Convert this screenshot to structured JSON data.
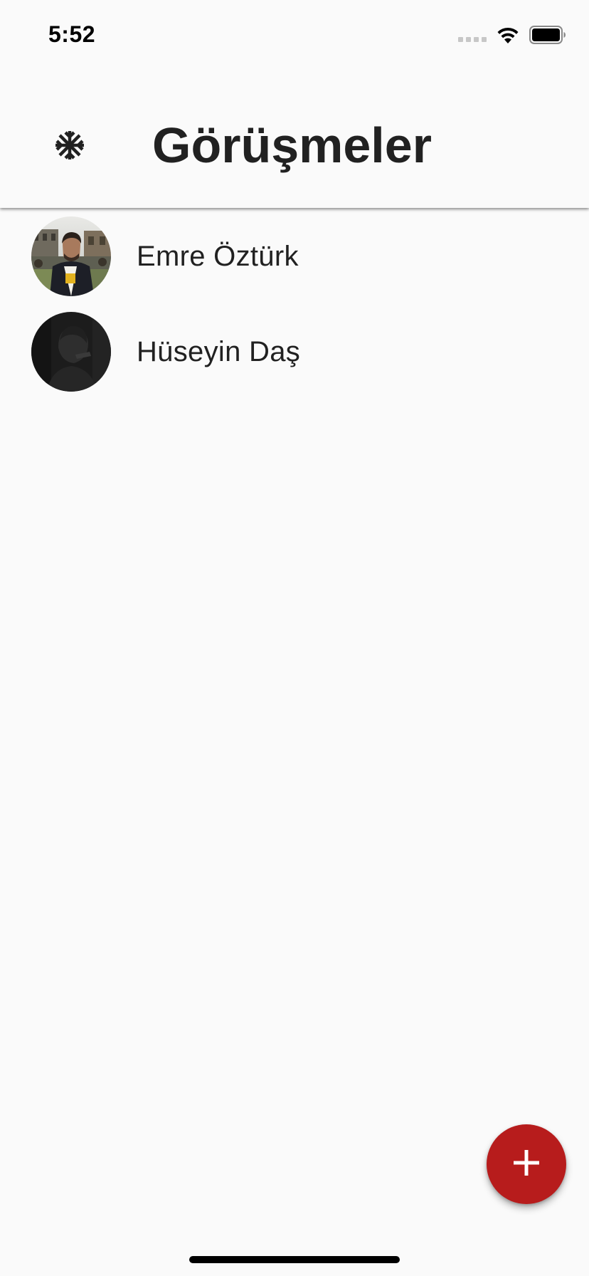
{
  "status_bar": {
    "time": "5:52",
    "icons": [
      "signal-icon",
      "wifi-icon",
      "battery-icon"
    ]
  },
  "app_bar": {
    "title": "Görüşmeler",
    "leading_icon": "snowflake-icon"
  },
  "contacts": [
    {
      "name": "Emre Öztürk",
      "avatar": "photo-avatar"
    },
    {
      "name": "Hüseyin Daş",
      "avatar": "photo-avatar"
    }
  ],
  "fab": {
    "icon": "plus-icon",
    "color": "#b71c1c"
  },
  "colors": {
    "background": "#fafafa",
    "text": "#212121",
    "accent": "#b71c1c"
  }
}
